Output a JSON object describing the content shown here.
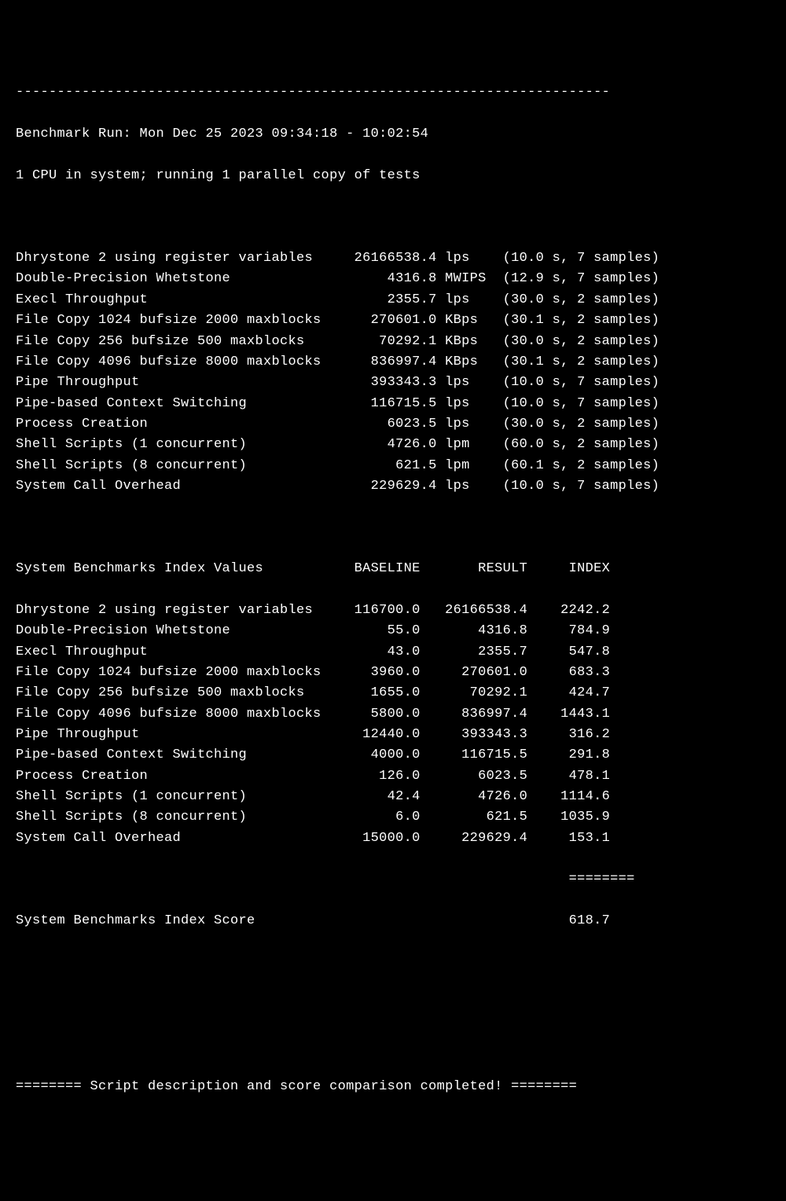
{
  "separator_top": "------------------------------------------------------------------------",
  "run_header": "Benchmark Run: Mon Dec 25 2023 09:34:18 - 10:02:54",
  "cpu_info": "1 CPU in system; running 1 parallel copy of tests",
  "results": [
    {
      "name": "Dhrystone 2 using register variables",
      "value": "26166538.4",
      "unit": "lps",
      "secs": "10.0",
      "samples": "7"
    },
    {
      "name": "Double-Precision Whetstone",
      "value": "4316.8",
      "unit": "MWIPS",
      "secs": "12.9",
      "samples": "7"
    },
    {
      "name": "Execl Throughput",
      "value": "2355.7",
      "unit": "lps",
      "secs": "30.0",
      "samples": "2"
    },
    {
      "name": "File Copy 1024 bufsize 2000 maxblocks",
      "value": "270601.0",
      "unit": "KBps",
      "secs": "30.1",
      "samples": "2"
    },
    {
      "name": "File Copy 256 bufsize 500 maxblocks",
      "value": "70292.1",
      "unit": "KBps",
      "secs": "30.0",
      "samples": "2"
    },
    {
      "name": "File Copy 4096 bufsize 8000 maxblocks",
      "value": "836997.4",
      "unit": "KBps",
      "secs": "30.1",
      "samples": "2"
    },
    {
      "name": "Pipe Throughput",
      "value": "393343.3",
      "unit": "lps",
      "secs": "10.0",
      "samples": "7"
    },
    {
      "name": "Pipe-based Context Switching",
      "value": "116715.5",
      "unit": "lps",
      "secs": "10.0",
      "samples": "7"
    },
    {
      "name": "Process Creation",
      "value": "6023.5",
      "unit": "lps",
      "secs": "30.0",
      "samples": "2"
    },
    {
      "name": "Shell Scripts (1 concurrent)",
      "value": "4726.0",
      "unit": "lpm",
      "secs": "60.0",
      "samples": "2"
    },
    {
      "name": "Shell Scripts (8 concurrent)",
      "value": "621.5",
      "unit": "lpm",
      "secs": "60.1",
      "samples": "2"
    },
    {
      "name": "System Call Overhead",
      "value": "229629.4",
      "unit": "lps",
      "secs": "10.0",
      "samples": "7"
    }
  ],
  "index_header": {
    "title": "System Benchmarks Index Values",
    "col1": "BASELINE",
    "col2": "RESULT",
    "col3": "INDEX"
  },
  "index_rows": [
    {
      "name": "Dhrystone 2 using register variables",
      "baseline": "116700.0",
      "result": "26166538.4",
      "index": "2242.2"
    },
    {
      "name": "Double-Precision Whetstone",
      "baseline": "55.0",
      "result": "4316.8",
      "index": "784.9"
    },
    {
      "name": "Execl Throughput",
      "baseline": "43.0",
      "result": "2355.7",
      "index": "547.8"
    },
    {
      "name": "File Copy 1024 bufsize 2000 maxblocks",
      "baseline": "3960.0",
      "result": "270601.0",
      "index": "683.3"
    },
    {
      "name": "File Copy 256 bufsize 500 maxblocks",
      "baseline": "1655.0",
      "result": "70292.1",
      "index": "424.7"
    },
    {
      "name": "File Copy 4096 bufsize 8000 maxblocks",
      "baseline": "5800.0",
      "result": "836997.4",
      "index": "1443.1"
    },
    {
      "name": "Pipe Throughput",
      "baseline": "12440.0",
      "result": "393343.3",
      "index": "316.2"
    },
    {
      "name": "Pipe-based Context Switching",
      "baseline": "4000.0",
      "result": "116715.5",
      "index": "291.8"
    },
    {
      "name": "Process Creation",
      "baseline": "126.0",
      "result": "6023.5",
      "index": "478.1"
    },
    {
      "name": "Shell Scripts (1 concurrent)",
      "baseline": "42.4",
      "result": "4726.0",
      "index": "1114.6"
    },
    {
      "name": "Shell Scripts (8 concurrent)",
      "baseline": "6.0",
      "result": "621.5",
      "index": "1035.9"
    },
    {
      "name": "System Call Overhead",
      "baseline": "15000.0",
      "result": "229629.4",
      "index": "153.1"
    }
  ],
  "score_divider": "                                                                   ========",
  "score_label": "System Benchmarks Index Score",
  "score_value": "618.7",
  "footer": "======== Script description and score comparison completed! ========"
}
